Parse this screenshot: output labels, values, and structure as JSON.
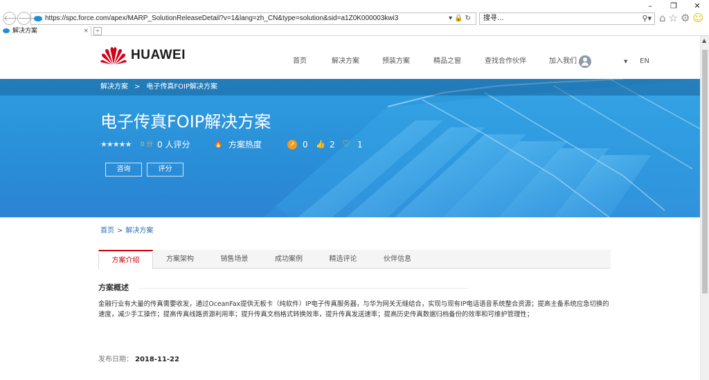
{
  "browser": {
    "window_controls": {
      "minimize": "–",
      "restore": "❐",
      "close": "✕"
    },
    "back_icon": "🡐",
    "forward_icon": "🡒",
    "address": "https://spc.force.com/apex/MARP_SolutionReleaseDetail?v=1&lang=zh_CN&type=solution&sid=a1Z0K000003kwi3",
    "address_tools": "▾🔒↻",
    "search_placeholder": "搜寻...",
    "search_tools": "⚲▾",
    "home_icon": "⌂",
    "star_icon": "☆",
    "gear_icon": "⚙",
    "smile_icon": "☺",
    "tab_title": "解决方案",
    "tab_close": "×",
    "newtab_icon": "+"
  },
  "site": {
    "logo_text": "HUAWEI",
    "nav": {
      "home": "首页",
      "solutions": "解决方案",
      "preinstalled": "预装方案",
      "showcase": "精品之窗",
      "find_partner": "查找合作伙伴",
      "join": "加入我们",
      "lang": "EN",
      "caret": "▼"
    }
  },
  "banner": {
    "crumb_root": "解决方案",
    "crumb_sep": ">",
    "crumb_current": "电子传真FOIP解决方案",
    "title": "电子传真FOIP解决方案",
    "stars": "★★★★★",
    "score": "0 分",
    "rating_count": "0 人评分",
    "heat_icon": "🔥",
    "heat_label": "方案热度",
    "share_icon": "↗",
    "share_count": "0",
    "like_icon": "👍",
    "like_count": "2",
    "favorite_icon": "♡",
    "favorite_count": "1",
    "consult_button": "咨询",
    "rate_button": "评分"
  },
  "breadcrumb": {
    "home": "首页",
    "sep": ">",
    "current": "解决方案"
  },
  "tabs": [
    {
      "label": "方案介绍",
      "active": true
    },
    {
      "label": "方案架构"
    },
    {
      "label": "销售场景"
    },
    {
      "label": "成功案例"
    },
    {
      "label": "精选评论"
    },
    {
      "label": "伙伴信息"
    }
  ],
  "overview": {
    "title": "方案概述",
    "body": "金融行业有大量的传真需要收发，通过OceanFax提供无板卡（纯软件）IP电子传真服务器，与华为网关无缝结合，实现与现有IP电话语音系统整合资源；提高主备系统应急切换的速度，减少手工操作；提高传真线路资源利用率；提升传真文档格式转换效率，提升传真发送速率；提高历史传真数据归档备份的效率和可维护管理性；"
  },
  "publish": {
    "label": "发布日期：",
    "date": "2018-11-22"
  },
  "colors": {
    "brand_red": "#c7000b",
    "banner_blue": "#2a8fd8",
    "link_blue": "#2d6fb5"
  }
}
